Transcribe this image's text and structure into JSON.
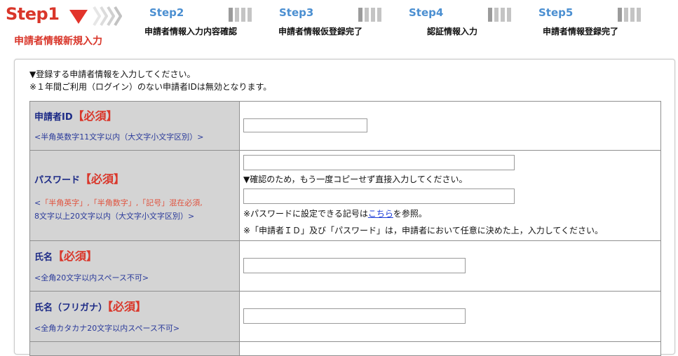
{
  "steps": {
    "step1": {
      "label": "Step1",
      "sub": "申請者情報新規入力"
    },
    "step2": {
      "label": "Step2",
      "sub": "申請者情報入力内容確認"
    },
    "step3": {
      "label": "Step3",
      "sub": "申請者情報仮登録完了"
    },
    "step4": {
      "label": "Step4",
      "sub": "認証情報入力"
    },
    "step5": {
      "label": "Step5",
      "sub": "申請者情報登録完了"
    }
  },
  "intro": {
    "line1": "▼登録する申請者情報を入力してください。",
    "line2": "※１年間ご利用（ログイン）のない申請者IDは無効となります。"
  },
  "form": {
    "required_label": "【必須】",
    "user_id": {
      "label": "申請者ID",
      "hint": "<半角英数字11文字以内（大文字小文字区別）>",
      "value": ""
    },
    "password": {
      "label": "パスワード",
      "hint_open": "<",
      "hint_red": "「半角英字」,「半角数字」,「記号」混在必須,",
      "hint_line2": "8文字以上20文字以内（大文字小文字区別）>",
      "value": "",
      "confirm_note": "▼確認のため，もう一度コピーせず直接入力してください。",
      "confirm_value": "",
      "symbols_note_pre": "※パスワードに設定できる記号は",
      "symbols_link": "こちら",
      "symbols_note_post": "を参照。",
      "decide_note": "※「申請者ＩＤ」及び「パスワード」は，申請者において任意に決めた上，入力してください。"
    },
    "name": {
      "label": "氏名",
      "hint": "<全角20文字以内スペース不可>",
      "value": ""
    },
    "name_kana": {
      "label": "氏名（フリガナ）",
      "hint": "<全角カタカナ20文字以内スペース不可>",
      "value": ""
    }
  }
}
